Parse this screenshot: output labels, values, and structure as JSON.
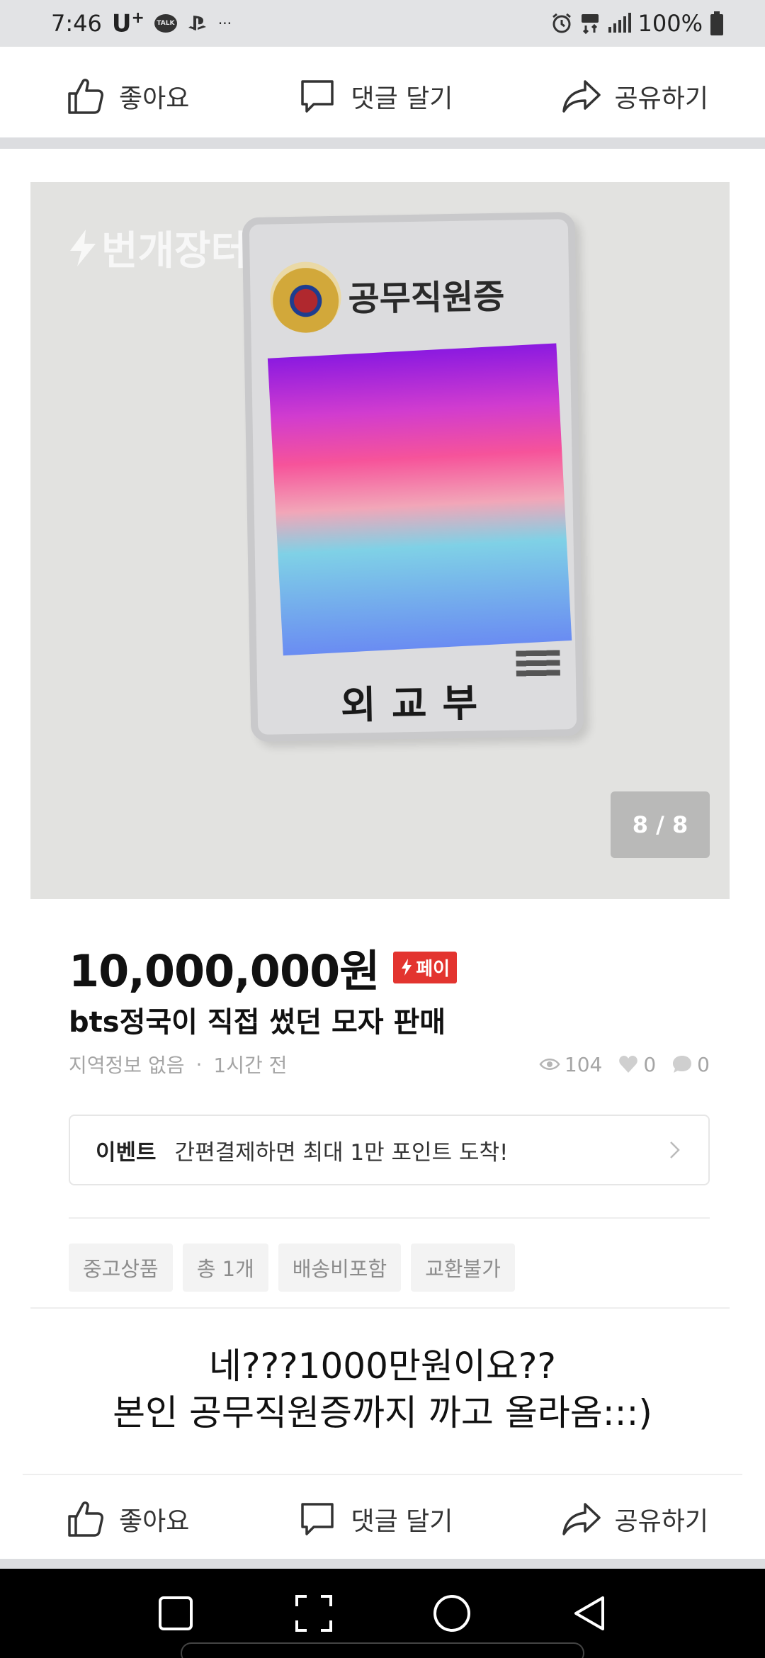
{
  "status_bar": {
    "time": "7:46",
    "carrier": "U",
    "carrier_sup": "+",
    "talk_icon_text": "TALK",
    "more": "···",
    "battery": "100%"
  },
  "actions": {
    "like": "좋아요",
    "comment": "댓글 달기",
    "share": "공유하기"
  },
  "photo": {
    "watermark": "번개장터",
    "card_title": "공무직원증",
    "card_department": "외교부",
    "page_counter": "8 / 8"
  },
  "listing": {
    "price": "10,000,000원",
    "pay_badge": "페이",
    "title": "bts정국이 직접 썼던 모자 판매",
    "location": "지역정보 없음",
    "separator": "·",
    "time_ago": "1시간 전",
    "views": "104",
    "likes": "0",
    "comments": "0"
  },
  "event": {
    "label": "이벤트",
    "text": "간편결제하면 최대 1만 포인트 도착!"
  },
  "tags": [
    "중고상품",
    "총 1개",
    "배송비포함",
    "교환불가"
  ],
  "caption": {
    "line1": "네???1000만원이요??",
    "line2": "본인 공무직원증까지 까고 올라옴:::)"
  },
  "colors": {
    "status_bg": "#e2e3e5",
    "divider": "#dcdde0",
    "pay_red": "#e3342f",
    "nav_bg": "#000000"
  }
}
